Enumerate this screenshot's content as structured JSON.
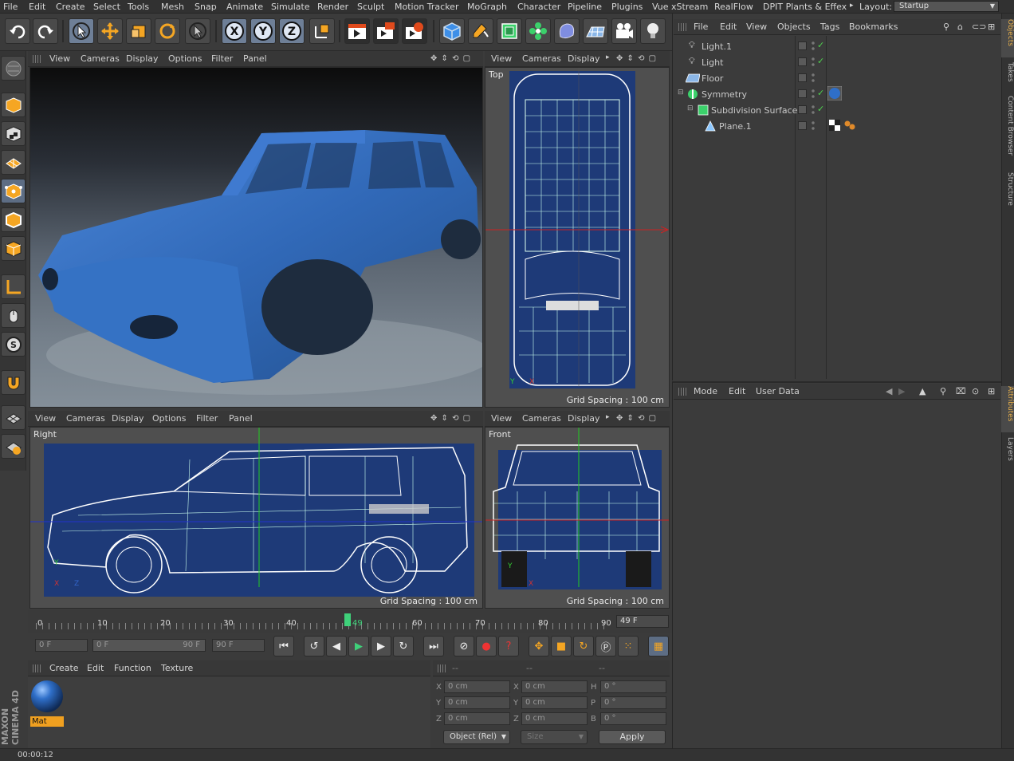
{
  "menu": [
    "File",
    "Edit",
    "Create",
    "Select",
    "Tools",
    "Mesh",
    "Snap",
    "Animate",
    "Simulate",
    "Render",
    "Sculpt",
    "Motion Tracker",
    "MoGraph",
    "Character",
    "Pipeline",
    "Plugins",
    "Vue xStream",
    "RealFlow",
    "DPIT Plants & Effex"
  ],
  "layout": {
    "label": "Layout:",
    "value": "Startup"
  },
  "toolbar_icons": [
    "undo-icon",
    "redo-icon",
    "live-selection-icon",
    "move-icon",
    "scale-icon",
    "rotate-icon",
    "last-tool-icon",
    "x-axis-icon",
    "y-axis-icon",
    "z-axis-icon",
    "coordinate-system-icon",
    "render-view-icon",
    "render-picture-viewer-icon",
    "render-settings-icon",
    "cube-icon",
    "pen-icon",
    "subdivision-icon",
    "cloner-icon",
    "deformer-icon",
    "floor-icon",
    "camera-icon",
    "light-icon"
  ],
  "viewport_perspective": {
    "menu": [
      "View",
      "Cameras",
      "Display",
      "Options",
      "Filter",
      "Panel"
    ]
  },
  "viewport_top": {
    "menu": [
      "View",
      "Cameras",
      "Display"
    ],
    "label": "Top",
    "grid": "Grid Spacing : 100 cm"
  },
  "viewport_right": {
    "menu": [
      "View",
      "Cameras",
      "Display",
      "Options",
      "Filter",
      "Panel"
    ],
    "label": "Right",
    "grid": "Grid Spacing : 100 cm"
  },
  "viewport_front": {
    "menu": [
      "View",
      "Cameras",
      "Display"
    ],
    "label": "Front",
    "grid": "Grid Spacing : 100 cm"
  },
  "object_manager": {
    "menu": [
      "File",
      "Edit",
      "View",
      "Objects",
      "Tags",
      "Bookmarks"
    ],
    "objects": [
      {
        "name": "Light.1",
        "checked": true
      },
      {
        "name": "Light",
        "checked": true
      },
      {
        "name": "Floor",
        "checked": false
      },
      {
        "name": "Symmetry",
        "checked": true
      },
      {
        "name": "Subdivision Surface",
        "checked": true
      },
      {
        "name": "Plane.1",
        "checked": false
      }
    ]
  },
  "side_tabs": {
    "top": [
      "Objects",
      "Takes",
      "Content Browser",
      "Structure"
    ],
    "bottom": [
      "Attributes",
      "Layers"
    ]
  },
  "attributes": {
    "menu": [
      "Mode",
      "Edit",
      "User Data"
    ]
  },
  "timeline": {
    "ticks": [
      "0",
      "10",
      "20",
      "30",
      "40",
      "49",
      "50",
      "60",
      "70",
      "80",
      "90"
    ],
    "current": "49",
    "frame_field": "49 F"
  },
  "playback": {
    "start": "0 F",
    "range_start": "0 F",
    "range_end": "90 F",
    "end": "90 F"
  },
  "material_manager": {
    "menu": [
      "Create",
      "Edit",
      "Function",
      "Texture"
    ],
    "material": "Mat"
  },
  "coords": {
    "header": [
      "--",
      "--",
      "--"
    ],
    "rows": [
      {
        "a": "X",
        "av": "0 cm",
        "b": "X",
        "bv": "0 cm",
        "c": "H",
        "cv": "0 °"
      },
      {
        "a": "Y",
        "av": "0 cm",
        "b": "Y",
        "bv": "0 cm",
        "c": "P",
        "cv": "0 °"
      },
      {
        "a": "Z",
        "av": "0 cm",
        "b": "Z",
        "bv": "0 cm",
        "c": "B",
        "cv": "0 °"
      }
    ],
    "mode": "Object (Rel)",
    "size": "Size",
    "apply": "Apply"
  },
  "brand": "MAXON CINEMA 4D",
  "status": "00:00:12"
}
